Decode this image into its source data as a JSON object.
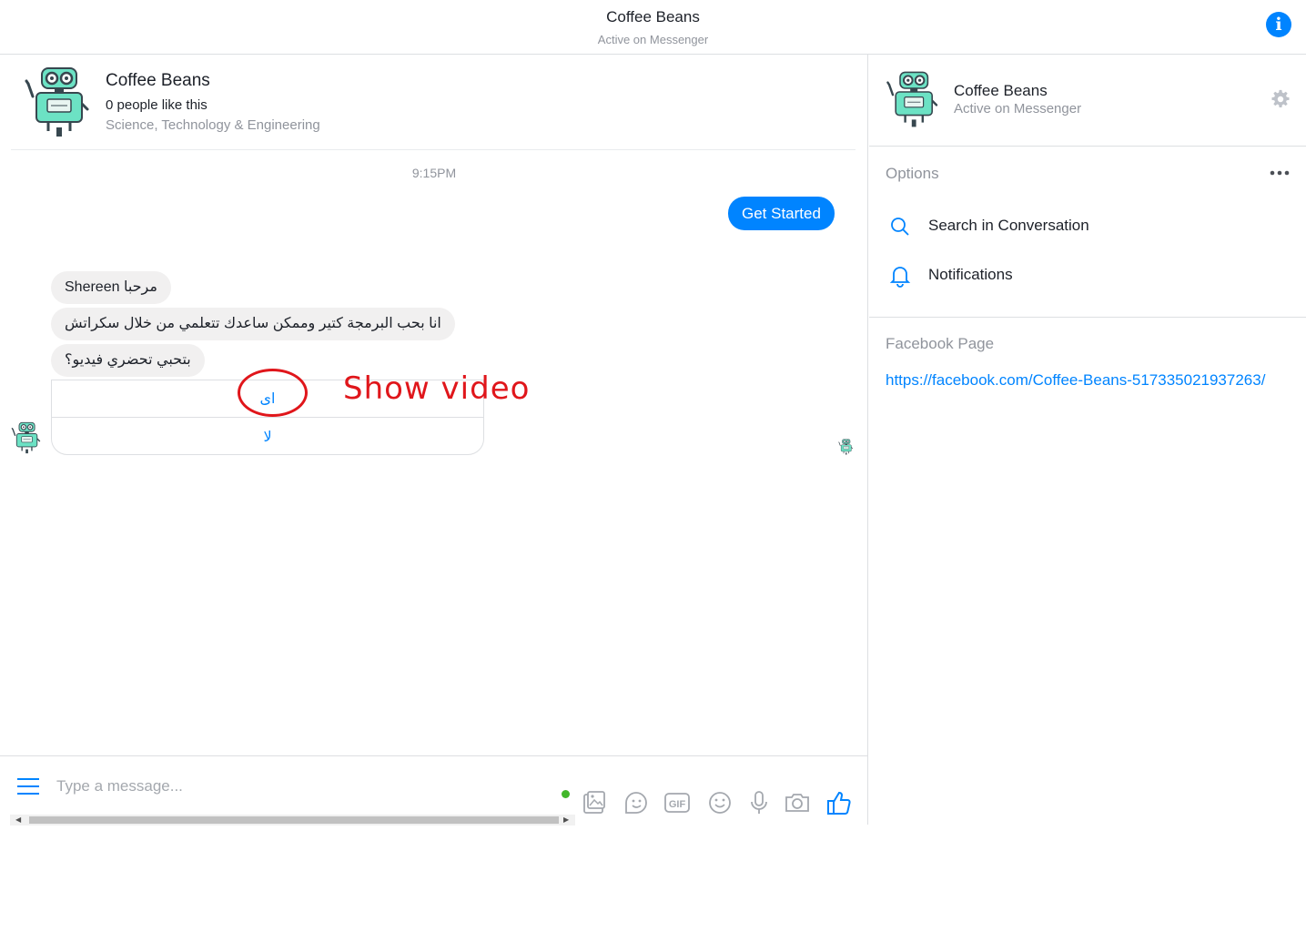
{
  "header": {
    "title": "Coffee Beans",
    "status": "Active on Messenger"
  },
  "page_info": {
    "name": "Coffee Beans",
    "likes": "0 people like this",
    "category": "Science, Technology & Engineering"
  },
  "conversation": {
    "timestamp": "9:15PM",
    "sent": [
      {
        "text": "Get Started"
      }
    ],
    "received": [
      {
        "text": "مرحبا Shereen"
      },
      {
        "text": "انا بحب البرمجة كتير وممكن ساعدك تتعلمي من خلال سكراتش"
      },
      {
        "text": "بتحبي تحضري فيديو؟"
      }
    ],
    "quick_replies": [
      "اى",
      "لا"
    ]
  },
  "annotation": {
    "text": "Show video",
    "color": "#e0161b"
  },
  "composer": {
    "placeholder": "Type a message...",
    "icons": [
      "menu-icon",
      "photo-icon",
      "sticker-icon",
      "gif-icon",
      "emoji-icon",
      "microphone-icon",
      "camera-icon",
      "thumbs-up-icon"
    ]
  },
  "right_panel": {
    "name": "Coffee Beans",
    "status": "Active on Messenger",
    "options_title": "Options",
    "options": [
      {
        "label": "Search in Conversation",
        "icon": "search-icon"
      },
      {
        "label": "Notifications",
        "icon": "bell-icon"
      }
    ],
    "facebook_page_title": "Facebook Page",
    "facebook_page_url": "https://facebook.com/Coffee-Beans-517335021937263/"
  },
  "colors": {
    "accent": "#0084ff",
    "bubble_gray": "#f1f0f0",
    "muted_text": "#90949c",
    "robot_teal": "#6ce2c4"
  }
}
